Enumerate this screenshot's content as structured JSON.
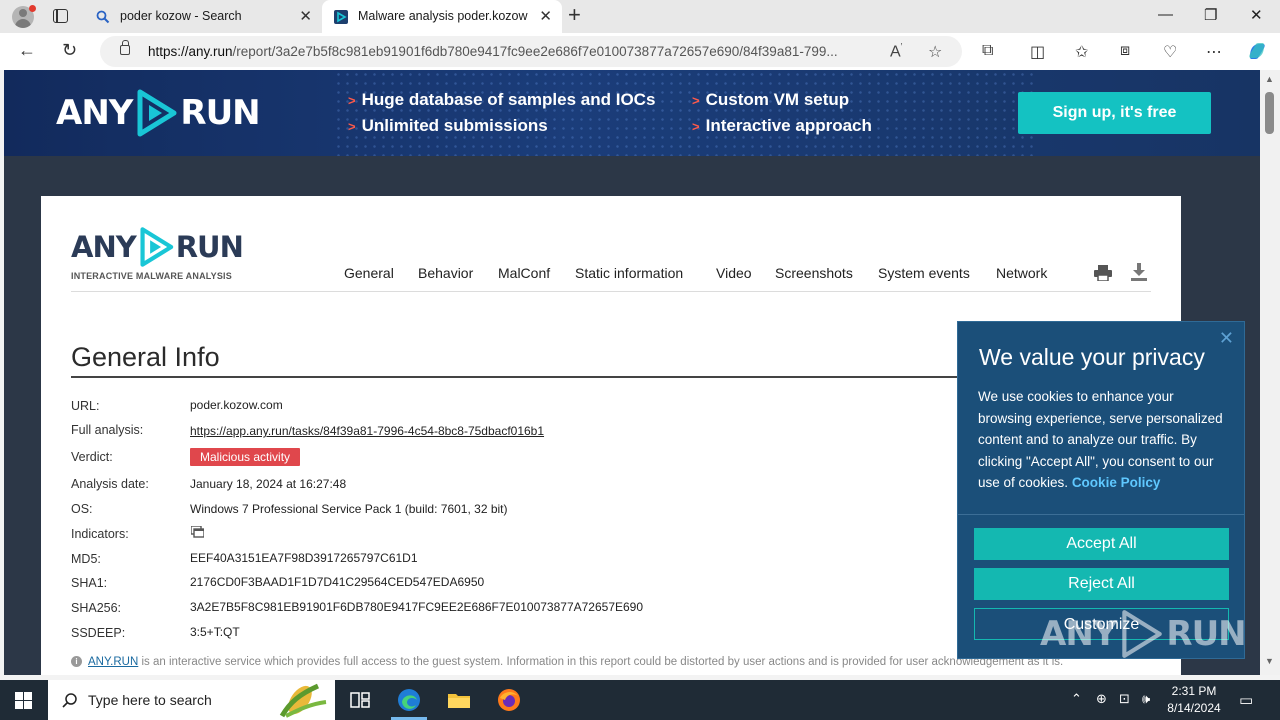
{
  "browser": {
    "tabs": [
      {
        "label": "poder kozow - Search"
      },
      {
        "label": "Malware analysis poder.kozow.com"
      }
    ],
    "url_host": "https://any.run",
    "url_path": "/report/3a2e7b5f8c981eb91901f6db780e9417fc9ee2e686f7e010073877a72657e690/84f39a81-799..."
  },
  "banner": {
    "logo_any": "ANY",
    "logo_run": "RUN",
    "features": [
      "Huge database of samples and IOCs",
      "Custom VM setup",
      "Unlimited submissions",
      "Interactive approach"
    ],
    "signup_label": "Sign up, it's free"
  },
  "report": {
    "logo_any": "ANY",
    "logo_run": "RUN",
    "logo_sub": "INTERACTIVE MALWARE ANALYSIS",
    "menu": [
      "General",
      "Behavior",
      "MalConf",
      "Static information",
      "Video",
      "Screenshots",
      "System events",
      "Network"
    ],
    "title": "General Info",
    "labels": {
      "url": "URL:",
      "full_analysis": "Full analysis:",
      "verdict": "Verdict:",
      "analysis_date": "Analysis date:",
      "os": "OS:",
      "indicators": "Indicators:",
      "md5": "MD5:",
      "sha1": "SHA1:",
      "sha256": "SHA256:",
      "ssdeep": "SSDEEP:"
    },
    "values": {
      "url": "poder.kozow.com",
      "full_analysis": "https://app.any.run/tasks/84f39a81-7996-4c54-8bc8-75dbacf016b1",
      "verdict": "Malicious activity",
      "analysis_date": "January 18, 2024 at 16:27:48",
      "os": "Windows 7 Professional Service Pack 1 (build: 7601, 32 bit)",
      "md5": "EEF40A3151EA7F98D3917265797C61D1",
      "sha1": "2176CD0F3BAAD1F1D7D41C29564CED547EDA6950",
      "sha256": "3A2E7B5F8C981EB91901F6DB780E9417FC9EE2E686F7E010073877A72657E690",
      "ssdeep": "3:5+T:QT"
    },
    "footnote_link": "ANY.RUN",
    "footnote_text": " is an interactive service which provides full access to the guest system. Information in this report could be distorted by user actions and is provided for user acknowledgement as it is."
  },
  "cookie": {
    "title": "We value your privacy",
    "body": "We use cookies to enhance your browsing experience, serve personalized content and to analyze our traffic. By clicking \"Accept All\", you consent to our use of cookies. ",
    "policy_link": "Cookie Policy",
    "accept": "Accept All",
    "reject": "Reject All",
    "customize": "Customize"
  },
  "taskbar": {
    "search_placeholder": "Type here to search",
    "time": "2:31 PM",
    "date": "8/14/2024"
  },
  "colors": {
    "banner_bg": "#1b3d7a",
    "signup": "#14c2c2",
    "verdict_bg": "#e0474c",
    "cookie_bg": "#1b4f79",
    "cookie_button": "#14b8b1",
    "accent_link": "#5fc8ff"
  }
}
